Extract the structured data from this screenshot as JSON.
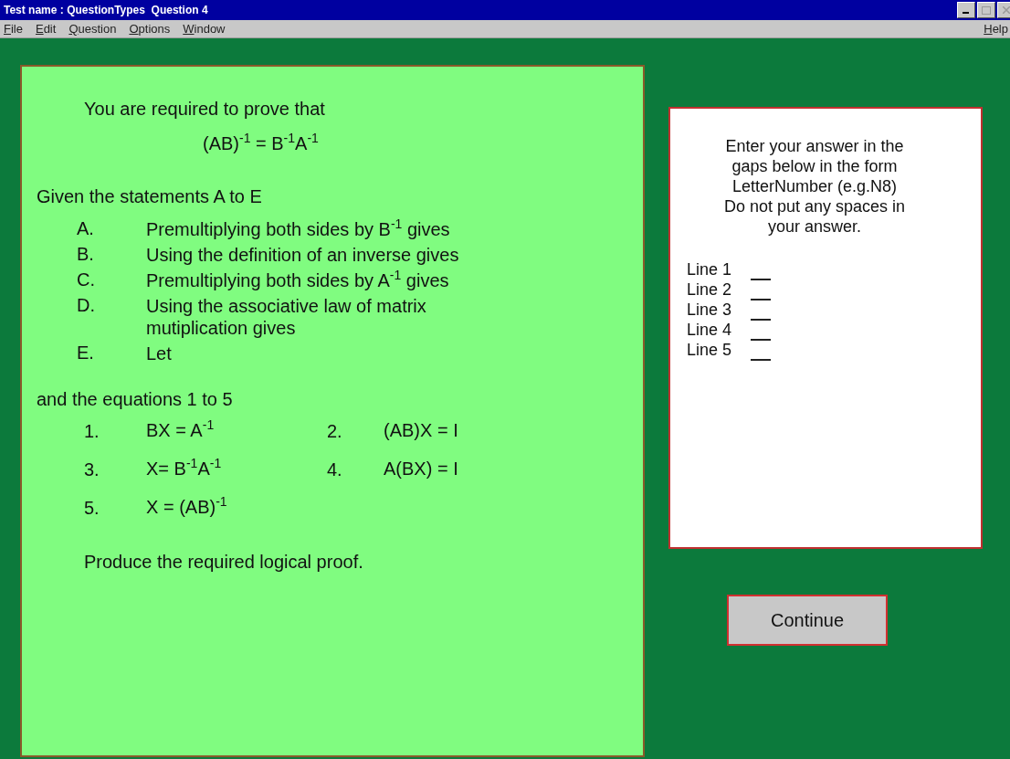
{
  "window": {
    "title": "Test name : QuestionTypes  Question 4"
  },
  "menu": {
    "items": [
      "File",
      "Edit",
      "Question",
      "Options",
      "Window"
    ],
    "help": "Help"
  },
  "question": {
    "intro": "You are required to prove that",
    "target": "(AB)$^{-1}$ = B$^{-1}$A$^{-1}$",
    "statements_heading": "Given the statements A to E",
    "statements": [
      {
        "label": "A.",
        "text": "Premultiplying both sides by B$^{-1}$ gives"
      },
      {
        "label": "B.",
        "text": "Using the definition of an inverse gives"
      },
      {
        "label": "C.",
        "text": "Premultiplying both sides by A$^{-1}$ gives"
      },
      {
        "label": "D.",
        "text": "Using the associative law of matrix mutiplication gives"
      },
      {
        "label": "E.",
        "text": "Let"
      }
    ],
    "equations_heading": "and the equations 1 to 5",
    "equations": [
      {
        "label": "1.",
        "text": "BX = A$^{-1}$"
      },
      {
        "label": "2.",
        "text": "(AB)X = I"
      },
      {
        "label": "3.",
        "text": "X= B$^{-1}$A$^{-1}$"
      },
      {
        "label": "4.",
        "text": "A(BX) = I"
      },
      {
        "label": "5.",
        "text": "X = (AB)$^{-1}$"
      }
    ],
    "instruction": "Produce the required logical proof."
  },
  "answer_panel": {
    "instructions": [
      "Enter your answer in the",
      "gaps below in the form",
      "LetterNumber (e.g.N8)",
      "Do not put any spaces in",
      "your answer."
    ],
    "lines": [
      {
        "label": "Line 1"
      },
      {
        "label": "Line 2"
      },
      {
        "label": "Line 3"
      },
      {
        "label": "Line 4"
      },
      {
        "label": "Line 5"
      }
    ]
  },
  "continue_button": "Continue"
}
